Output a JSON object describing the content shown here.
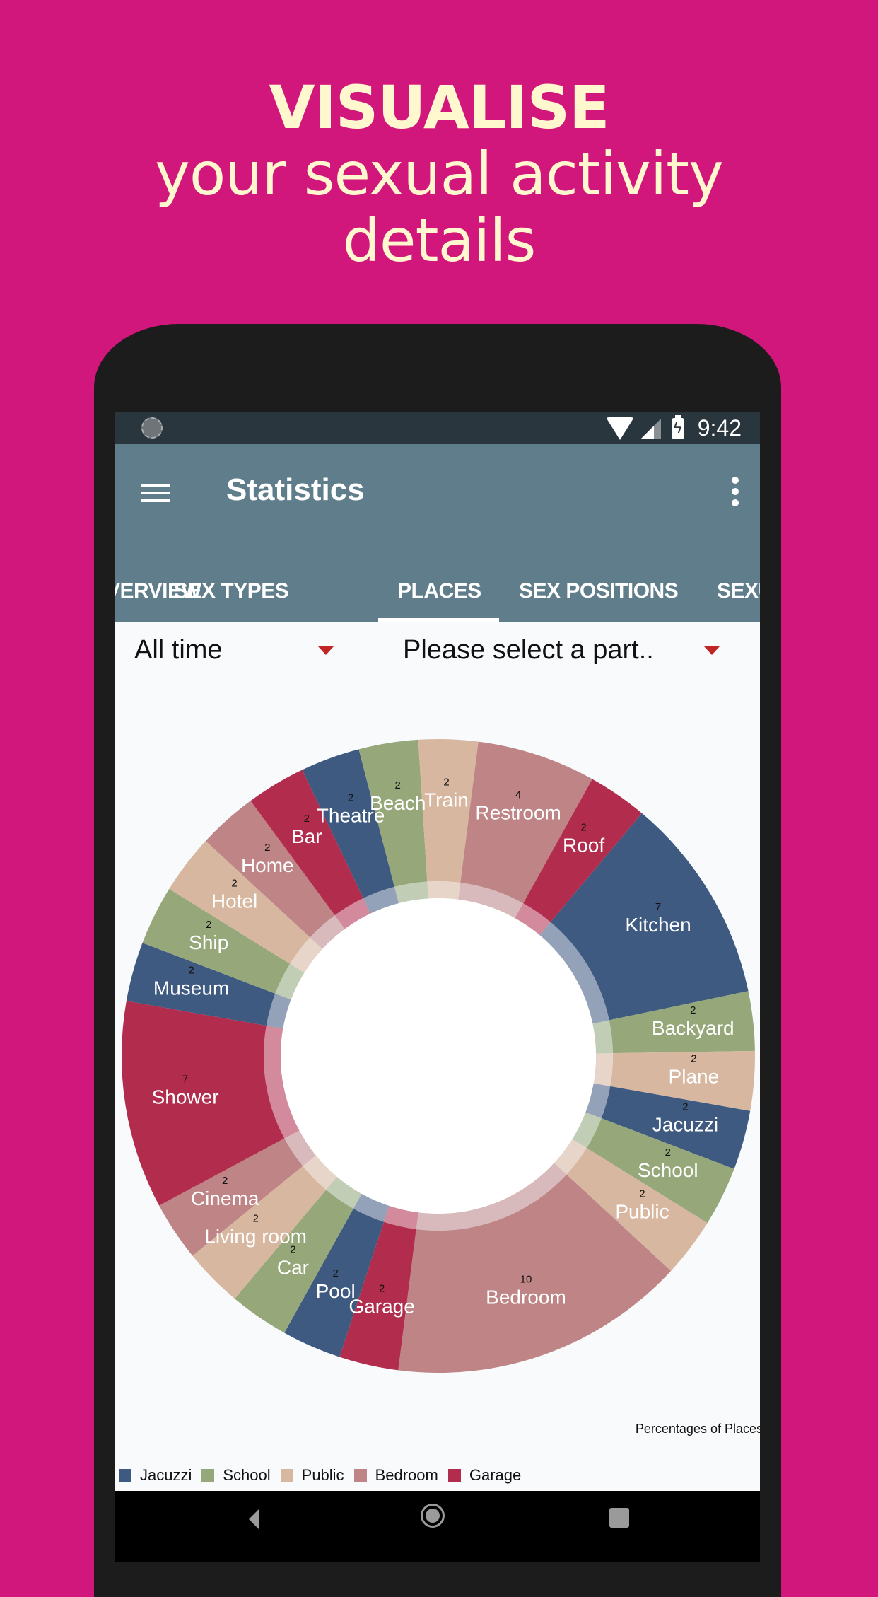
{
  "promo": {
    "line1": "VISUALISE",
    "line2": "your sexual activity",
    "line3": "details",
    "background_color": "#D1167C",
    "text_color": "#FFF8CF"
  },
  "statusbar": {
    "time": "9:42",
    "icons": [
      "sync-icon",
      "wifi-icon",
      "signal-icon",
      "battery-charging-icon"
    ]
  },
  "appbar": {
    "title": "Statistics",
    "menu_icon": "hamburger-menu-icon",
    "overflow_icon": "more-vert-icon",
    "color": "#607D8B"
  },
  "tabs": [
    {
      "label": "VERVIEW",
      "selected": false
    },
    {
      "label": "SEX TYPES",
      "selected": false
    },
    {
      "label": "PLACES",
      "selected": true
    },
    {
      "label": "SEX POSITIONS",
      "selected": false
    },
    {
      "label": "SEXU",
      "selected": false
    }
  ],
  "filters": {
    "time_range": {
      "value": "All time"
    },
    "partner": {
      "value": "Please select a part.."
    }
  },
  "navbar": {
    "back": "back-icon",
    "home": "home-icon",
    "recent": "recent-apps-icon"
  },
  "chart_data": {
    "type": "pie",
    "subtype": "donut",
    "description": "Percentages of Places",
    "legend_position": "bottom-left",
    "palette": {
      "blue": "#3F5A80",
      "green": "#96A87A",
      "peach": "#D8B7A0",
      "rose": "#BE8486",
      "red": "#B22D4D"
    },
    "slices": [
      {
        "label": "Kitchen",
        "value": 7,
        "color": "#3F5A80"
      },
      {
        "label": "Backyard",
        "value": 2,
        "color": "#96A87A"
      },
      {
        "label": "Plane",
        "value": 2,
        "color": "#D8B7A0"
      },
      {
        "label": "Jacuzzi",
        "value": 2,
        "color": "#3F5A80"
      },
      {
        "label": "School",
        "value": 2,
        "color": "#96A87A"
      },
      {
        "label": "Public",
        "value": 2,
        "color": "#D8B7A0"
      },
      {
        "label": "Bedroom",
        "value": 10,
        "color": "#BE8486"
      },
      {
        "label": "Garage",
        "value": 2,
        "color": "#B22D4D"
      },
      {
        "label": "Pool",
        "value": 2,
        "color": "#3F5A80"
      },
      {
        "label": "Car",
        "value": 2,
        "color": "#96A87A"
      },
      {
        "label": "Living room",
        "value": 2,
        "color": "#D8B7A0"
      },
      {
        "label": "Cinema",
        "value": 2,
        "color": "#BE8486"
      },
      {
        "label": "Shower",
        "value": 7,
        "color": "#B22D4D"
      },
      {
        "label": "Museum",
        "value": 2,
        "color": "#3F5A80"
      },
      {
        "label": "Ship",
        "value": 2,
        "color": "#96A87A"
      },
      {
        "label": "Hotel",
        "value": 2,
        "color": "#D8B7A0"
      },
      {
        "label": "Home",
        "value": 2,
        "color": "#BE8486"
      },
      {
        "label": "Bar",
        "value": 2,
        "color": "#B22D4D"
      },
      {
        "label": "Theatre",
        "value": 2,
        "color": "#3F5A80"
      },
      {
        "label": "Beach",
        "value": 2,
        "color": "#96A87A"
      },
      {
        "label": "Train",
        "value": 2,
        "color": "#D8B7A0"
      },
      {
        "label": "Restroom",
        "value": 4,
        "color": "#BE8486"
      },
      {
        "label": "Roof",
        "value": 2,
        "color": "#B22D4D"
      }
    ],
    "start_angle_deg_clockwise_from_top": 40,
    "legend": [
      {
        "label": "Jacuzzi",
        "color": "#3F5A80"
      },
      {
        "label": "School",
        "color": "#96A87A"
      },
      {
        "label": "Public",
        "color": "#D8B7A0"
      },
      {
        "label": "Bedroom",
        "color": "#BE8486"
      },
      {
        "label": "Garage",
        "color": "#B22D4D"
      }
    ]
  }
}
